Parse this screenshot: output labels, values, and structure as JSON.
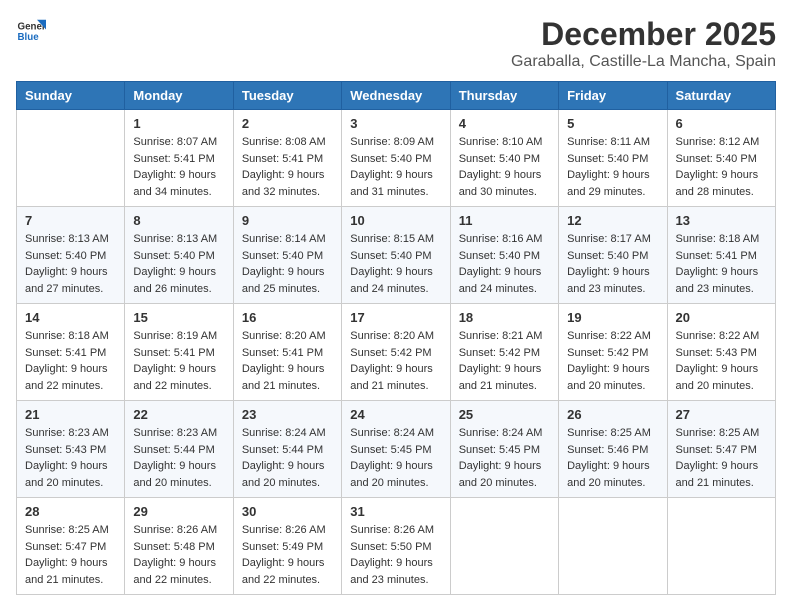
{
  "header": {
    "logo_general": "General",
    "logo_blue": "Blue",
    "title": "December 2025",
    "subtitle": "Garaballa, Castille-La Mancha, Spain"
  },
  "weekdays": [
    "Sunday",
    "Monday",
    "Tuesday",
    "Wednesday",
    "Thursday",
    "Friday",
    "Saturday"
  ],
  "weeks": [
    [
      {
        "day": "",
        "info": ""
      },
      {
        "day": "1",
        "info": "Sunrise: 8:07 AM\nSunset: 5:41 PM\nDaylight: 9 hours\nand 34 minutes."
      },
      {
        "day": "2",
        "info": "Sunrise: 8:08 AM\nSunset: 5:41 PM\nDaylight: 9 hours\nand 32 minutes."
      },
      {
        "day": "3",
        "info": "Sunrise: 8:09 AM\nSunset: 5:40 PM\nDaylight: 9 hours\nand 31 minutes."
      },
      {
        "day": "4",
        "info": "Sunrise: 8:10 AM\nSunset: 5:40 PM\nDaylight: 9 hours\nand 30 minutes."
      },
      {
        "day": "5",
        "info": "Sunrise: 8:11 AM\nSunset: 5:40 PM\nDaylight: 9 hours\nand 29 minutes."
      },
      {
        "day": "6",
        "info": "Sunrise: 8:12 AM\nSunset: 5:40 PM\nDaylight: 9 hours\nand 28 minutes."
      }
    ],
    [
      {
        "day": "7",
        "info": "Sunrise: 8:13 AM\nSunset: 5:40 PM\nDaylight: 9 hours\nand 27 minutes."
      },
      {
        "day": "8",
        "info": "Sunrise: 8:13 AM\nSunset: 5:40 PM\nDaylight: 9 hours\nand 26 minutes."
      },
      {
        "day": "9",
        "info": "Sunrise: 8:14 AM\nSunset: 5:40 PM\nDaylight: 9 hours\nand 25 minutes."
      },
      {
        "day": "10",
        "info": "Sunrise: 8:15 AM\nSunset: 5:40 PM\nDaylight: 9 hours\nand 24 minutes."
      },
      {
        "day": "11",
        "info": "Sunrise: 8:16 AM\nSunset: 5:40 PM\nDaylight: 9 hours\nand 24 minutes."
      },
      {
        "day": "12",
        "info": "Sunrise: 8:17 AM\nSunset: 5:40 PM\nDaylight: 9 hours\nand 23 minutes."
      },
      {
        "day": "13",
        "info": "Sunrise: 8:18 AM\nSunset: 5:41 PM\nDaylight: 9 hours\nand 23 minutes."
      }
    ],
    [
      {
        "day": "14",
        "info": "Sunrise: 8:18 AM\nSunset: 5:41 PM\nDaylight: 9 hours\nand 22 minutes."
      },
      {
        "day": "15",
        "info": "Sunrise: 8:19 AM\nSunset: 5:41 PM\nDaylight: 9 hours\nand 22 minutes."
      },
      {
        "day": "16",
        "info": "Sunrise: 8:20 AM\nSunset: 5:41 PM\nDaylight: 9 hours\nand 21 minutes."
      },
      {
        "day": "17",
        "info": "Sunrise: 8:20 AM\nSunset: 5:42 PM\nDaylight: 9 hours\nand 21 minutes."
      },
      {
        "day": "18",
        "info": "Sunrise: 8:21 AM\nSunset: 5:42 PM\nDaylight: 9 hours\nand 21 minutes."
      },
      {
        "day": "19",
        "info": "Sunrise: 8:22 AM\nSunset: 5:42 PM\nDaylight: 9 hours\nand 20 minutes."
      },
      {
        "day": "20",
        "info": "Sunrise: 8:22 AM\nSunset: 5:43 PM\nDaylight: 9 hours\nand 20 minutes."
      }
    ],
    [
      {
        "day": "21",
        "info": "Sunrise: 8:23 AM\nSunset: 5:43 PM\nDaylight: 9 hours\nand 20 minutes."
      },
      {
        "day": "22",
        "info": "Sunrise: 8:23 AM\nSunset: 5:44 PM\nDaylight: 9 hours\nand 20 minutes."
      },
      {
        "day": "23",
        "info": "Sunrise: 8:24 AM\nSunset: 5:44 PM\nDaylight: 9 hours\nand 20 minutes."
      },
      {
        "day": "24",
        "info": "Sunrise: 8:24 AM\nSunset: 5:45 PM\nDaylight: 9 hours\nand 20 minutes."
      },
      {
        "day": "25",
        "info": "Sunrise: 8:24 AM\nSunset: 5:45 PM\nDaylight: 9 hours\nand 20 minutes."
      },
      {
        "day": "26",
        "info": "Sunrise: 8:25 AM\nSunset: 5:46 PM\nDaylight: 9 hours\nand 20 minutes."
      },
      {
        "day": "27",
        "info": "Sunrise: 8:25 AM\nSunset: 5:47 PM\nDaylight: 9 hours\nand 21 minutes."
      }
    ],
    [
      {
        "day": "28",
        "info": "Sunrise: 8:25 AM\nSunset: 5:47 PM\nDaylight: 9 hours\nand 21 minutes."
      },
      {
        "day": "29",
        "info": "Sunrise: 8:26 AM\nSunset: 5:48 PM\nDaylight: 9 hours\nand 22 minutes."
      },
      {
        "day": "30",
        "info": "Sunrise: 8:26 AM\nSunset: 5:49 PM\nDaylight: 9 hours\nand 22 minutes."
      },
      {
        "day": "31",
        "info": "Sunrise: 8:26 AM\nSunset: 5:50 PM\nDaylight: 9 hours\nand 23 minutes."
      },
      {
        "day": "",
        "info": ""
      },
      {
        "day": "",
        "info": ""
      },
      {
        "day": "",
        "info": ""
      }
    ]
  ]
}
